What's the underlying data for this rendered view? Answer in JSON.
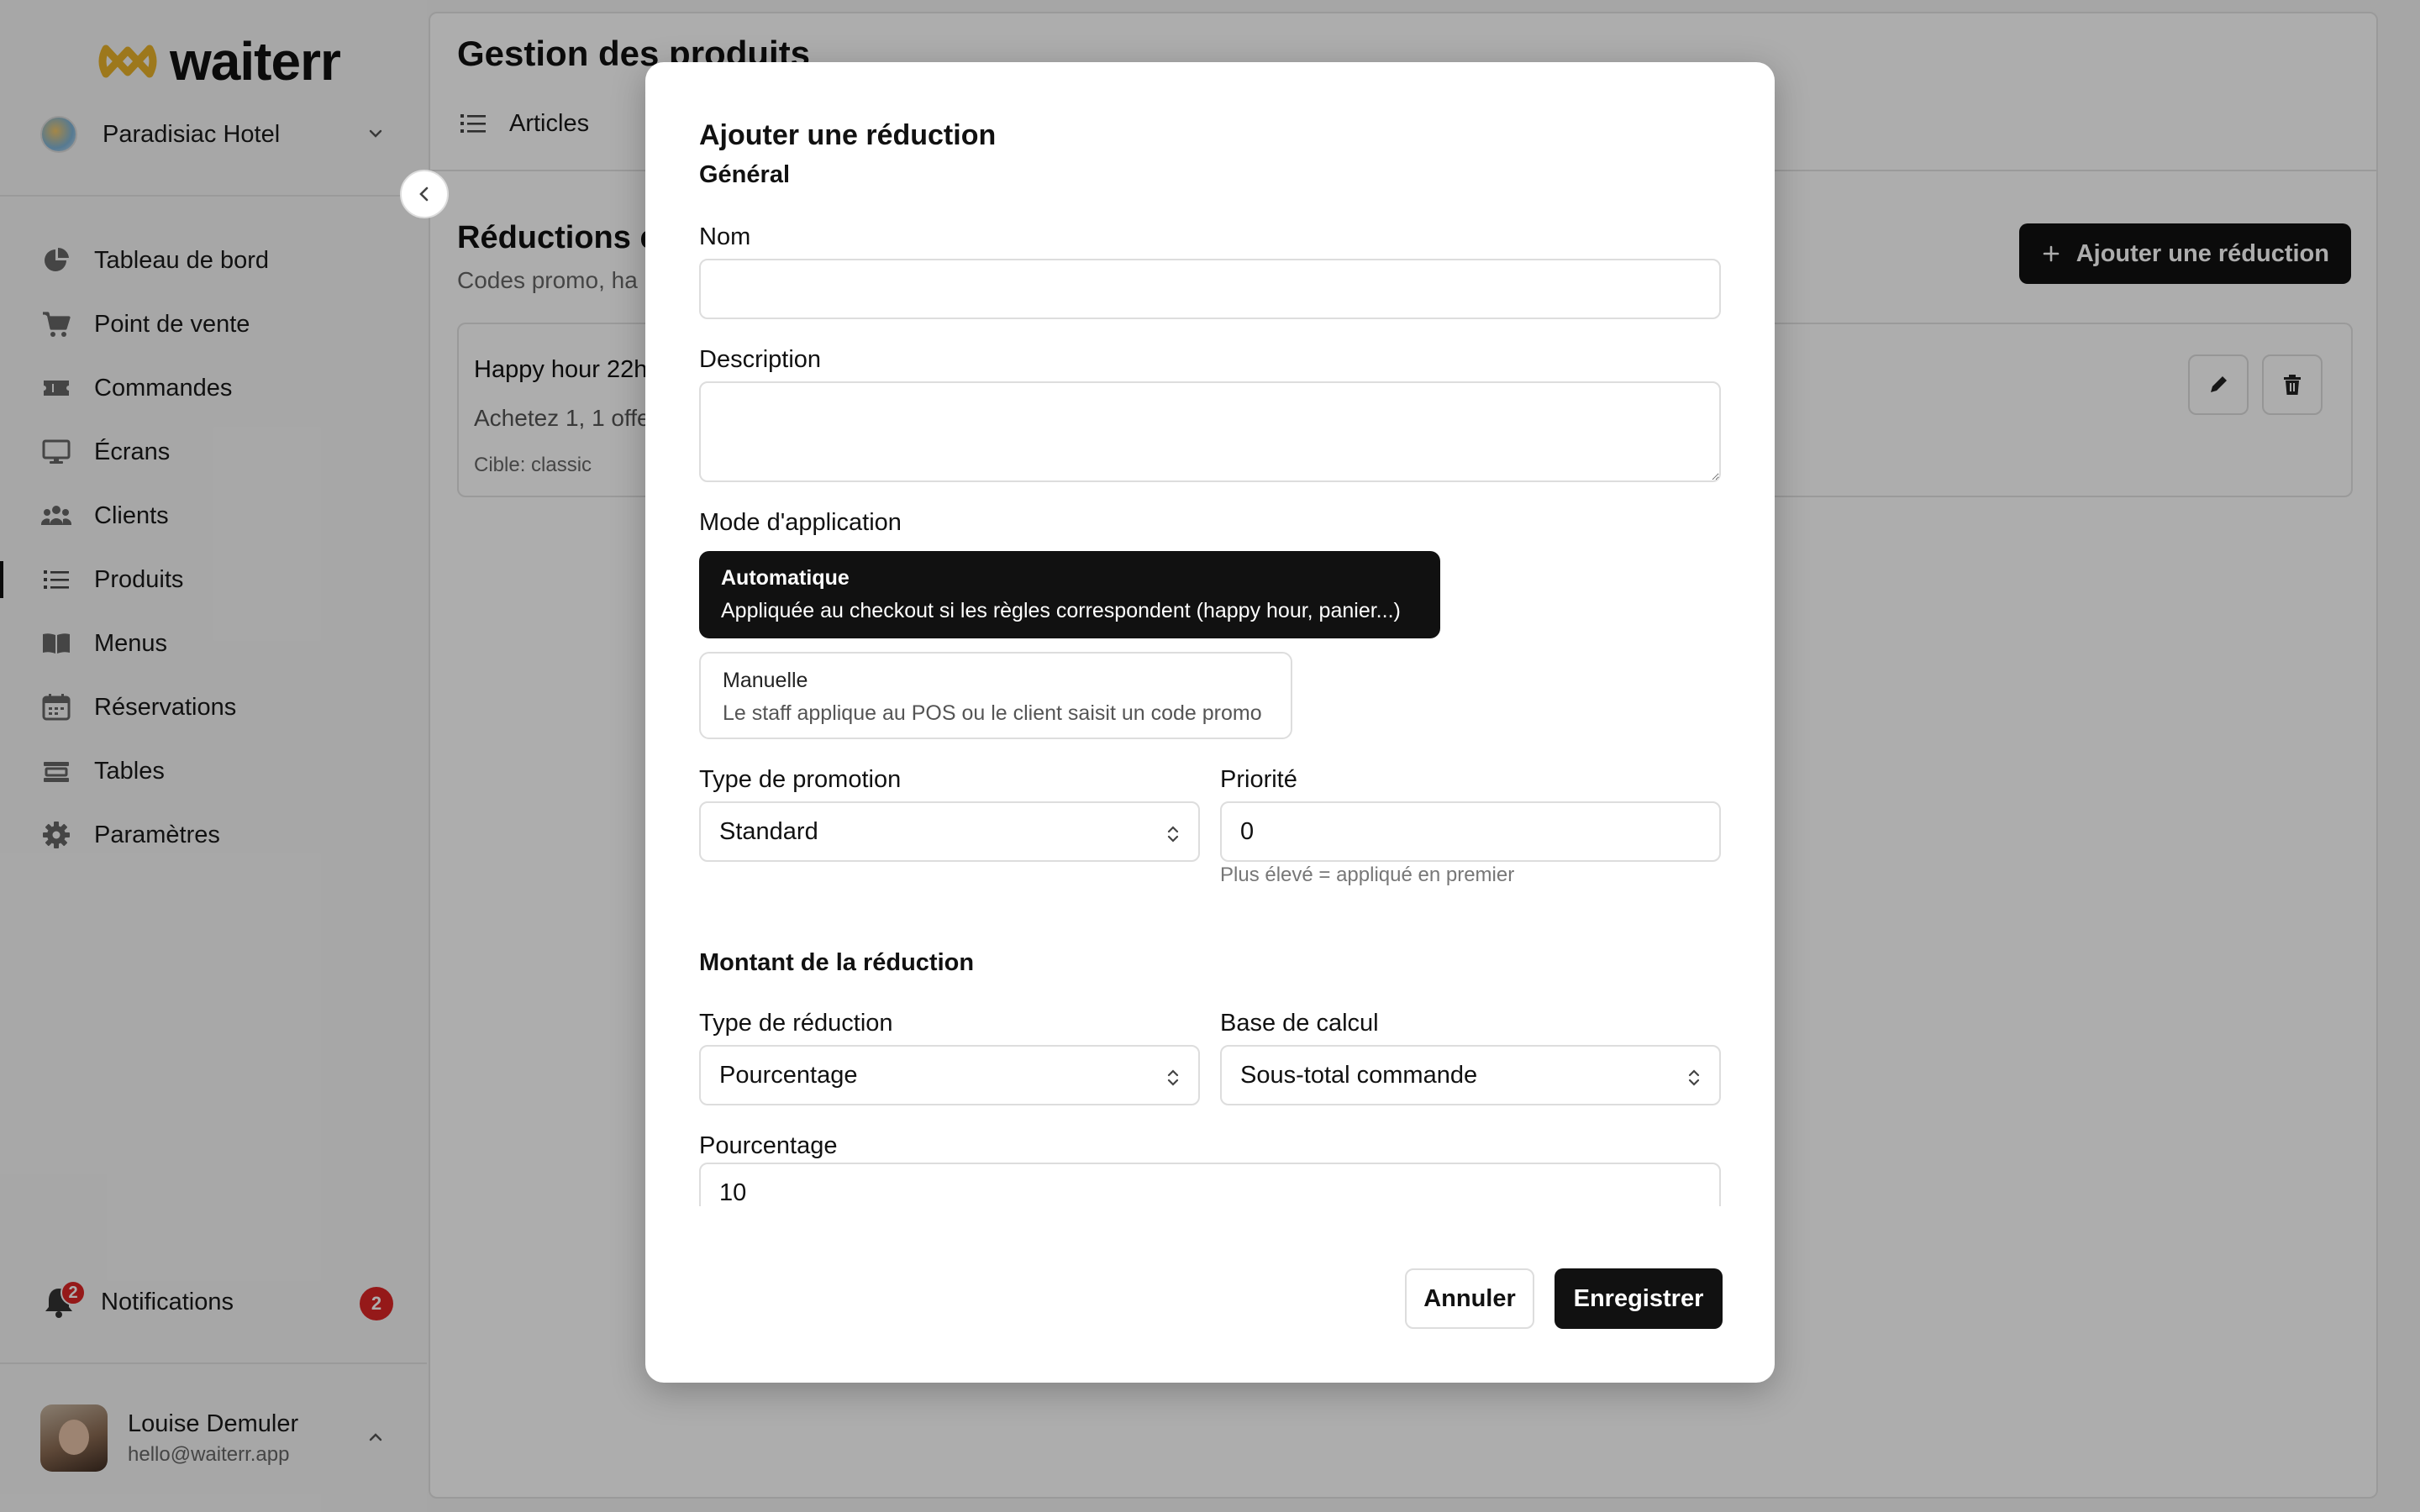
{
  "sidebar": {
    "logo_text": "waiterr",
    "hotel_name": "Paradisiac Hotel",
    "nav": [
      {
        "label": "Tableau de bord",
        "icon": "pie-chart-icon"
      },
      {
        "label": "Point de vente",
        "icon": "cart-icon"
      },
      {
        "label": "Commandes",
        "icon": "ticket-icon"
      },
      {
        "label": "Écrans",
        "icon": "monitor-icon"
      },
      {
        "label": "Clients",
        "icon": "users-icon"
      },
      {
        "label": "Produits",
        "icon": "list-icon"
      },
      {
        "label": "Menus",
        "icon": "book-icon"
      },
      {
        "label": "Réservations",
        "icon": "calendar-icon"
      },
      {
        "label": "Tables",
        "icon": "table-icon"
      },
      {
        "label": "Paramètres",
        "icon": "gear-icon"
      }
    ],
    "active_item": "Produits",
    "notifications_label": "Notifications",
    "notifications_count": "2",
    "user_name": "Louise Demuler",
    "user_email": "hello@waiterr.app"
  },
  "main": {
    "page_title": "Gestion des produits",
    "tab_label": "Articles",
    "section_title": "Réductions e",
    "section_subtitle": "Codes promo, ha",
    "add_button_label": "Ajouter une réduction",
    "card": {
      "title": "Happy hour 22h",
      "description": "Achetez 1, 1 offe",
      "target": "Cible: classic"
    }
  },
  "modal": {
    "title": "Ajouter une réduction",
    "section_general": "Général",
    "name_label": "Nom",
    "name_value": "",
    "description_label": "Description",
    "description_value": "",
    "mode_label": "Mode d'application",
    "mode_auto_title": "Automatique",
    "mode_auto_desc": "Appliquée au checkout si les règles correspondent (happy hour, panier...)",
    "mode_manual_title": "Manuelle",
    "mode_manual_desc": "Le staff applique au POS ou le client saisit un code promo",
    "promo_type_label": "Type de promotion",
    "promo_type_value": "Standard",
    "priority_label": "Priorité",
    "priority_value": "0",
    "priority_hint": "Plus élevé = appliqué en premier",
    "amount_heading": "Montant de la réduction",
    "discount_type_label": "Type de réduction",
    "discount_type_value": "Pourcentage",
    "calc_base_label": "Base de calcul",
    "calc_base_value": "Sous-total commande",
    "percentage_label": "Pourcentage",
    "percentage_value": "10",
    "cancel_label": "Annuler",
    "save_label": "Enregistrer"
  },
  "colors": {
    "accent": "#111111",
    "badge": "#dc2626",
    "logo_mark": "#e8b22a"
  }
}
